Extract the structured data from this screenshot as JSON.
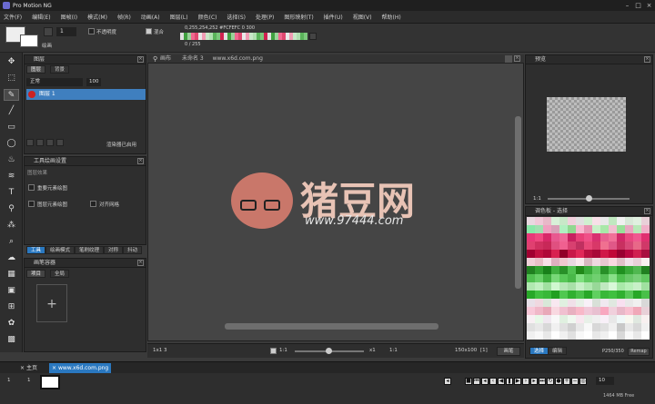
{
  "app": {
    "title": "Pro Motion NG"
  },
  "menu": [
    "文件(F)",
    "编辑(E)",
    "图帧(I)",
    "模式(M)",
    "帧(R)",
    "动画(A)",
    "图层(L)",
    "颜色(C)",
    "选择(S)",
    "处理(P)",
    "图形映射(T)",
    "插件(U)",
    "视图(V)",
    "帮助(H)"
  ],
  "toolbar": {
    "frame_value": "1",
    "not_transparent": "不透明度",
    "mix": "混合",
    "color_info": "0,255,254,252 #FCFEFC 0 300",
    "color_index": "0 / 255",
    "fg_label": "绘画"
  },
  "layers": {
    "title": "图层",
    "tabs": [
      "图层",
      "背景"
    ],
    "mode": "正常",
    "opacity": "100",
    "layer_name": "图层 1",
    "blend_label": "渲染器已启用",
    "blend_value": "a1"
  },
  "tool_settings": {
    "title": "工具绘画设置",
    "section": "图层效果",
    "options": [
      "重要元素绘图",
      "图层元素绘图",
      "对齐网格"
    ]
  },
  "tool_tabs": [
    "工具",
    "绘画模式",
    "笔刷纹理",
    "对称",
    "抖动"
  ],
  "brushes": {
    "title": "画笔容器",
    "tabs": [
      "项目",
      "全局"
    ]
  },
  "canvas": {
    "tab_label": "画布",
    "name": "未命名 3",
    "url": "www.x6d.com.png",
    "status_left": "1x1 3",
    "zoom": "1:1",
    "zoom_value": "x1",
    "zoom_ratio": "1:1",
    "size": "150x100",
    "size_badge": "[1]",
    "brush": "画笔"
  },
  "preview": {
    "title": "预览",
    "zoom": "1:1"
  },
  "palette": {
    "title": "调色板 - 选择",
    "tabs": [
      "选择",
      "编辑"
    ],
    "range": "P250/350",
    "btn": "Remap"
  },
  "watermark": {
    "brand": "猪豆网",
    "site": "www.97444.com"
  },
  "bottom_tabs": [
    "主页",
    "www.x6d.com.png"
  ],
  "timeline": {
    "frame_num": "1",
    "frame_label": "1",
    "fps": "10",
    "memory": "1464 MB  Free"
  },
  "colors": {
    "accent": "#2a78c0",
    "selected_layer": "#3f7fbf"
  }
}
